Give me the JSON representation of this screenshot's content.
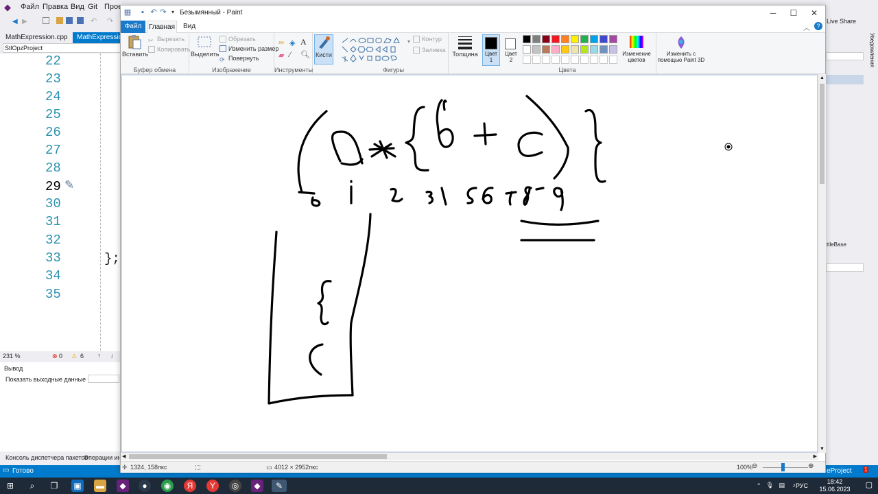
{
  "vs": {
    "menu": [
      "Файл",
      "Правка",
      "Вид",
      "Git",
      "Прое"
    ],
    "tabs": [
      "MathExpression.cpp",
      "MathExpression.h"
    ],
    "project": "StlOpzProject",
    "line_numbers": [
      "22",
      "23",
      "24",
      "25",
      "26",
      "27",
      "28",
      "29",
      "30",
      "31",
      "32",
      "33",
      "34",
      "35"
    ],
    "code_brace": "};",
    "zoom": "231 %",
    "errors": "0",
    "warnings": "6",
    "output_title": "Вывод",
    "output_from": "Показать выходные данные из:",
    "bottom_tabs": [
      "Консоль диспетчера пакетов",
      "Операции инс"
    ],
    "status": "Готово",
    "status_right": "eProject",
    "live_share": "Live Share",
    "notifications": "Уведомления",
    "right_panel_label": "ttleBase"
  },
  "paint": {
    "title": "Безымянный - Paint",
    "tabs": {
      "file": "Файл",
      "home": "Главная",
      "view": "Вид"
    },
    "clipboard": {
      "paste": "Вставить",
      "cut": "Вырезать",
      "copy": "Копировать",
      "label": "Буфер обмена"
    },
    "image": {
      "select": "Выделить",
      "crop": "Обрезать",
      "resize": "Изменить размер",
      "rotate": "Повернуть",
      "label": "Изображение"
    },
    "tools": {
      "label": "Инструменты"
    },
    "brushes": {
      "label": "Кисти"
    },
    "shapes": {
      "outline": "Контур",
      "fill": "Заливка",
      "label": "Фигуры"
    },
    "size": {
      "label": "Толщина"
    },
    "color1": {
      "label": "Цвет 1",
      "value": "#000000"
    },
    "color2": {
      "label": "Цвет 2",
      "value": "#ffffff"
    },
    "colors_label": "Цвета",
    "edit_colors": "Изменение цветов",
    "paint3d": "Изменить с помощью Paint 3D",
    "palette": [
      "#000000",
      "#7f7f7f",
      "#880015",
      "#ed1c24",
      "#ff7f27",
      "#fff200",
      "#22b14c",
      "#00a2e8",
      "#3f48cc",
      "#a349a4",
      "#ffffff",
      "#c3c3c3",
      "#b97a57",
      "#ffaec9",
      "#ffc90e",
      "#efe4b0",
      "#b5e61d",
      "#99d9ea",
      "#7092be",
      "#c8bfe7"
    ],
    "status": {
      "cursor": "1324, 158пкс",
      "canvas_size": "4012 × 2952пкс",
      "zoom": "100%"
    }
  },
  "taskbar": {
    "lang": "РУС",
    "time": "18:42",
    "date": "15.06.2023"
  }
}
